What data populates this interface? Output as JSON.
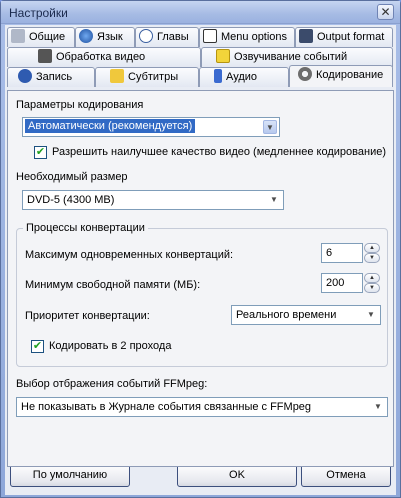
{
  "window": {
    "title": "Настройки",
    "close_glyph": "✕"
  },
  "tabs": {
    "row1": [
      {
        "label": "Общие",
        "icon": "wrench-icon"
      },
      {
        "label": "Язык",
        "icon": "globe-icon"
      },
      {
        "label": "Главы",
        "icon": "clock-icon"
      },
      {
        "label": "Menu options",
        "icon": "menu-icon"
      },
      {
        "label": "Output format",
        "icon": "monitor-icon"
      }
    ],
    "row2": [
      {
        "label": "Обработка видео",
        "icon": "film-icon"
      },
      {
        "label": "Озвучивание событий",
        "icon": "speech-icon"
      }
    ],
    "row3": [
      {
        "label": "Запись",
        "icon": "record-icon"
      },
      {
        "label": "Субтитры",
        "icon": "subtitles-icon"
      },
      {
        "label": "Аудио",
        "icon": "music-note-icon"
      },
      {
        "label": "Кодирование",
        "icon": "gear-icon"
      }
    ],
    "active": "Кодирование"
  },
  "encoding": {
    "params_label": "Параметры кодирования",
    "params_value": "Автоматически (рекомендуется)",
    "best_quality_label": "Разрешить наилучшее качество видео (медленнее кодирование)",
    "best_quality_checked": true,
    "size_label": "Необходимый размер",
    "size_value": "DVD-5 (4300 MB)"
  },
  "conversion": {
    "group_title": "Процессы конвертации",
    "max_conv_label": "Максимум одновременных конвертаций:",
    "max_conv_value": "6",
    "min_mem_label": "Минимум свободной памяти (МБ):",
    "min_mem_value": "200",
    "priority_label": "Приоритет конвертации:",
    "priority_value": "Реального времени",
    "two_pass_label": "Кодировать в 2 прохода",
    "two_pass_checked": true
  },
  "ffmpeg": {
    "label": "Выбор отбражения событий FFMpeg:",
    "value": "Не показывать в Журнале события связанные с FFMpeg"
  },
  "footer": {
    "default_label": "По умолчанию",
    "ok_label": "OK",
    "cancel_label": "Отмена"
  },
  "glyphs": {
    "combo_arrow": "▼",
    "spin_up": "▲",
    "spin_down": "▼",
    "check": "✔"
  }
}
